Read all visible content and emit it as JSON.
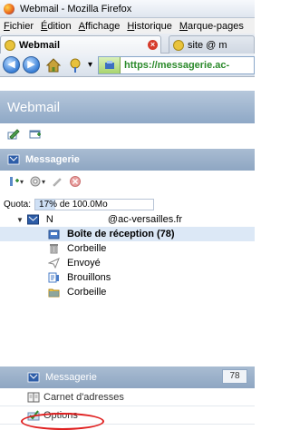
{
  "window": {
    "title": "Webmail - Mozilla Firefox"
  },
  "menubar": {
    "items": [
      {
        "label": "Fichier",
        "u": "F",
        "rest": "ichier"
      },
      {
        "label": "Édition",
        "u": "É",
        "rest": "dition"
      },
      {
        "label": "Affichage",
        "u": "A",
        "rest": "ffichage"
      },
      {
        "label": "Historique",
        "u": "H",
        "rest": "istorique"
      },
      {
        "label": "Marque-pages",
        "u": "M",
        "rest": "arque-pages"
      }
    ]
  },
  "tabs": {
    "active": {
      "label": "Webmail"
    },
    "inactive": {
      "label": "site @ m"
    }
  },
  "navbar": {
    "url": "https://messagerie.ac-"
  },
  "app": {
    "title": "Webmail"
  },
  "mail": {
    "section_title": "Messagerie",
    "quota_label": "Quota:",
    "quota_text": "17% de 100.0Mo",
    "quota_fraction": 0.17,
    "account": {
      "prefix": "N",
      "domain": "@ac-versailles.fr"
    },
    "folders": [
      {
        "label": "Boîte de réception (78)",
        "icon": "inbox-icon",
        "selected": true
      },
      {
        "label": "Corbeille",
        "icon": "trash-icon",
        "selected": false
      },
      {
        "label": "Envoyé",
        "icon": "sent-icon",
        "selected": false
      },
      {
        "label": "Brouillons",
        "icon": "drafts-icon",
        "selected": false
      },
      {
        "label": "Corbeille",
        "icon": "folder-icon",
        "selected": false
      }
    ]
  },
  "bottom": {
    "messagerie_label": "Messagerie",
    "messagerie_count": "78",
    "address_book_label": "Carnet d'adresses",
    "options_label": "Options"
  },
  "colors": {
    "header": "#8ea6c2",
    "selected": "#dce8f6",
    "highlight_ring": "#e02020"
  }
}
